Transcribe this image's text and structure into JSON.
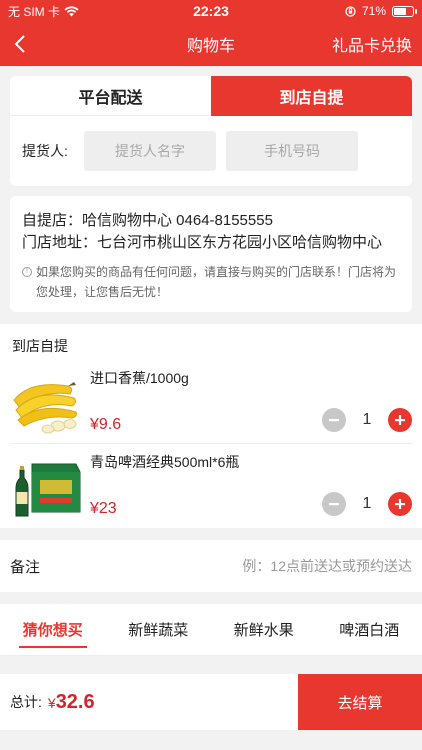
{
  "status_bar": {
    "carrier": "无 SIM 卡",
    "time": "22:23",
    "battery_text": "71%",
    "battery_level": 0.71
  },
  "nav": {
    "title": "购物车",
    "right_action": "礼品卡兑换"
  },
  "delivery": {
    "tabs": [
      {
        "label": "平台配送",
        "active": false
      },
      {
        "label": "到店自提",
        "active": true
      }
    ],
    "pickup_label": "提货人:",
    "name_placeholder": "提货人名字",
    "phone_placeholder": "手机号码"
  },
  "store": {
    "store_line": "自提店：哈信购物中心 0464-8155555",
    "address_line": "门店地址：七台河市桃山区东方花园小区哈信购物中心",
    "notice": "如果您购买的商品有任何问题，请直接与购买的门店联系！门店将为您处理，让您售后无忧！"
  },
  "cart": {
    "section_title": "到店自提",
    "items": [
      {
        "name": "进口香蕉/1000g",
        "price": "¥9.6",
        "qty": "1",
        "image": "banana-image"
      },
      {
        "name": "青岛啤酒经典500ml*6瓶",
        "price": "¥23",
        "qty": "1",
        "image": "beer-image"
      }
    ]
  },
  "remark": {
    "label": "备注",
    "hint": "例：12点前送达或预约送达"
  },
  "recommend": {
    "tabs": [
      {
        "label": "猜你想买",
        "active": true
      },
      {
        "label": "新鲜蔬菜",
        "active": false
      },
      {
        "label": "新鲜水果",
        "active": false
      },
      {
        "label": "啤酒白酒",
        "active": false
      }
    ]
  },
  "footer": {
    "total_label": "总计:",
    "currency": "¥",
    "total": "32.6",
    "checkout_label": "去结算"
  },
  "colors": {
    "accent": "#e8372f",
    "price": "#d4232b"
  }
}
